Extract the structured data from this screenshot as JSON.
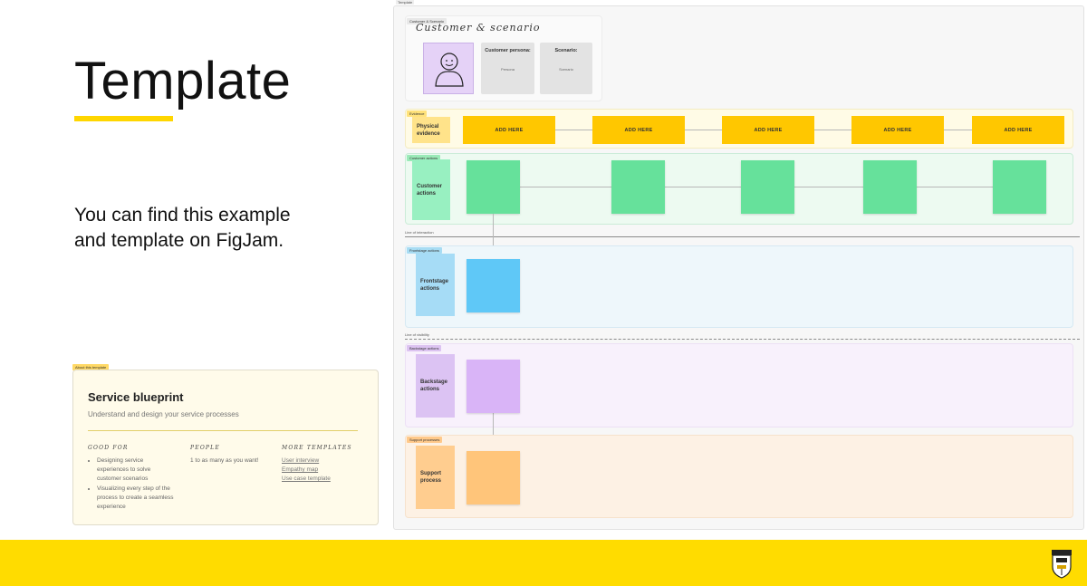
{
  "slide": {
    "title": "Template",
    "body": "You can find this example and template on FigJam."
  },
  "about": {
    "tag": "About this template",
    "title": "Service blueprint",
    "subtitle": "Understand and design your service processes",
    "good_for": {
      "heading": "GOOD FOR",
      "items": [
        "Designing service experiences to solve customer scenarios",
        "Visualizing every step of the process to create a seamless experience"
      ]
    },
    "people": {
      "heading": "PEOPLE",
      "text": "1 to as many as you want!"
    },
    "more_templates": {
      "heading": "MORE TEMPLATES",
      "links": [
        "User interview",
        "Empathy map",
        "Use case template"
      ]
    }
  },
  "board": {
    "tag": "Template",
    "customer_scenario": {
      "tag": "Customer & Scenario",
      "title": "Customer & scenario",
      "persona_title": "Customer persona:",
      "persona_text": "Persona",
      "scenario_title": "Scenario:",
      "scenario_text": "Scenario"
    },
    "evidence": {
      "tag": "Evidence",
      "label": "Physical evidence",
      "sticky_text": "ADD HERE",
      "sticky_count": 5
    },
    "customer_actions": {
      "tag": "Customer actions",
      "label": "Customer actions"
    },
    "line_of_interaction": "Line of interaction",
    "frontstage": {
      "tag": "Frontstage actions",
      "label": "Frontstage actions"
    },
    "line_of_visibility": "Line of visibility",
    "backstage": {
      "tag": "Backstage actions",
      "label": "Backstage actions"
    },
    "support": {
      "tag": "Support processes",
      "label": "Support process"
    }
  },
  "colors": {
    "accent_yellow": "#ffdc00",
    "sticky_green": "#66e19b",
    "sticky_blue": "#5fc8f7",
    "sticky_purple": "#d9b4f7",
    "sticky_orange": "#ffc57a",
    "evidence_yellow": "#ffc700"
  },
  "icons": {
    "crest": "university-crest-icon",
    "persona": "person-sketch-icon"
  }
}
